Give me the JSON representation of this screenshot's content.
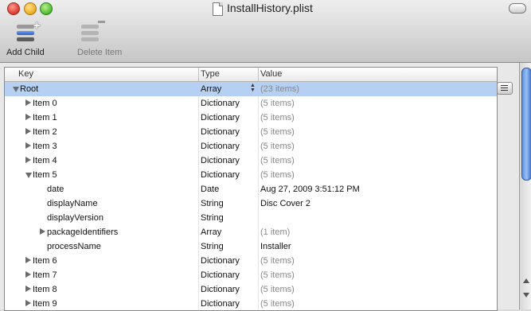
{
  "window": {
    "title": "InstallHistory.plist"
  },
  "toolbar": {
    "add_child_label": "Add Child",
    "delete_item_label": "Delete Item"
  },
  "columns": {
    "key": "Key",
    "type": "Type",
    "value": "Value"
  },
  "rows": [
    {
      "key": "Root",
      "type": "Array",
      "value": "(23 items)",
      "expand": "down",
      "indent": 0,
      "dim": true
    },
    {
      "key": "Item 0",
      "type": "Dictionary",
      "value": "(5 items)",
      "expand": "right",
      "indent": 1,
      "dim": true
    },
    {
      "key": "Item 1",
      "type": "Dictionary",
      "value": "(5 items)",
      "expand": "right",
      "indent": 1,
      "dim": true
    },
    {
      "key": "Item 2",
      "type": "Dictionary",
      "value": "(5 items)",
      "expand": "right",
      "indent": 1,
      "dim": true
    },
    {
      "key": "Item 3",
      "type": "Dictionary",
      "value": "(5 items)",
      "expand": "right",
      "indent": 1,
      "dim": true
    },
    {
      "key": "Item 4",
      "type": "Dictionary",
      "value": "(5 items)",
      "expand": "right",
      "indent": 1,
      "dim": true
    },
    {
      "key": "Item 5",
      "type": "Dictionary",
      "value": "(5 items)",
      "expand": "down",
      "indent": 1,
      "dim": true
    },
    {
      "key": "date",
      "type": "Date",
      "value": "Aug 27, 2009 3:51:12 PM",
      "expand": "none",
      "indent": 2,
      "dim": false
    },
    {
      "key": "displayName",
      "type": "String",
      "value": "Disc Cover 2",
      "expand": "none",
      "indent": 2,
      "dim": false
    },
    {
      "key": "displayVersion",
      "type": "String",
      "value": "",
      "expand": "none",
      "indent": 2,
      "dim": false
    },
    {
      "key": "packageIdentifiers",
      "type": "Array",
      "value": "(1 item)",
      "expand": "right",
      "indent": 2,
      "dim": true
    },
    {
      "key": "processName",
      "type": "String",
      "value": "Installer",
      "expand": "none",
      "indent": 2,
      "dim": false
    },
    {
      "key": "Item 6",
      "type": "Dictionary",
      "value": "(5 items)",
      "expand": "right",
      "indent": 1,
      "dim": true
    },
    {
      "key": "Item 7",
      "type": "Dictionary",
      "value": "(5 items)",
      "expand": "right",
      "indent": 1,
      "dim": true
    },
    {
      "key": "Item 8",
      "type": "Dictionary",
      "value": "(5 items)",
      "expand": "right",
      "indent": 1,
      "dim": true
    },
    {
      "key": "Item 9",
      "type": "Dictionary",
      "value": "(5 items)",
      "expand": "right",
      "indent": 1,
      "dim": true
    }
  ],
  "selected_row": "Root"
}
